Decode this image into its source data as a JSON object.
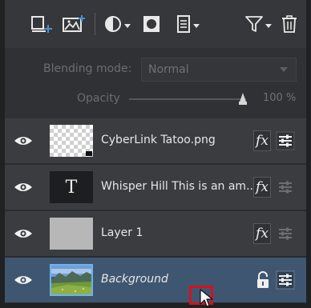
{
  "toolbar": {
    "buttons": [
      {
        "name": "new-layer-icon"
      },
      {
        "name": "add-image-icon"
      },
      {
        "name": "adjustment-icon"
      },
      {
        "name": "mask-icon"
      },
      {
        "name": "layer-menu-icon"
      },
      {
        "name": "filter-icon"
      },
      {
        "name": "trash-icon"
      }
    ]
  },
  "blending": {
    "label": "Blending mode:",
    "value": "Normal"
  },
  "opacity": {
    "label": "Opacity",
    "value": "100 %",
    "level": 1.0
  },
  "layers": [
    {
      "name": "CyberLink Tatoo.png",
      "thumb": "checker",
      "selected": false
    },
    {
      "name": "Whisper Hill  This is an am...",
      "thumb": "text",
      "thumb_glyph": "T",
      "selected": false
    },
    {
      "name": "Layer 1",
      "thumb": "gray",
      "selected": false
    },
    {
      "name": "Background",
      "thumb": "landscape",
      "selected": true,
      "locked": true
    }
  ],
  "fx_label": "fx",
  "colors": {
    "selected_row": "#3f5670",
    "cursor_highlight": "#d4121a"
  }
}
